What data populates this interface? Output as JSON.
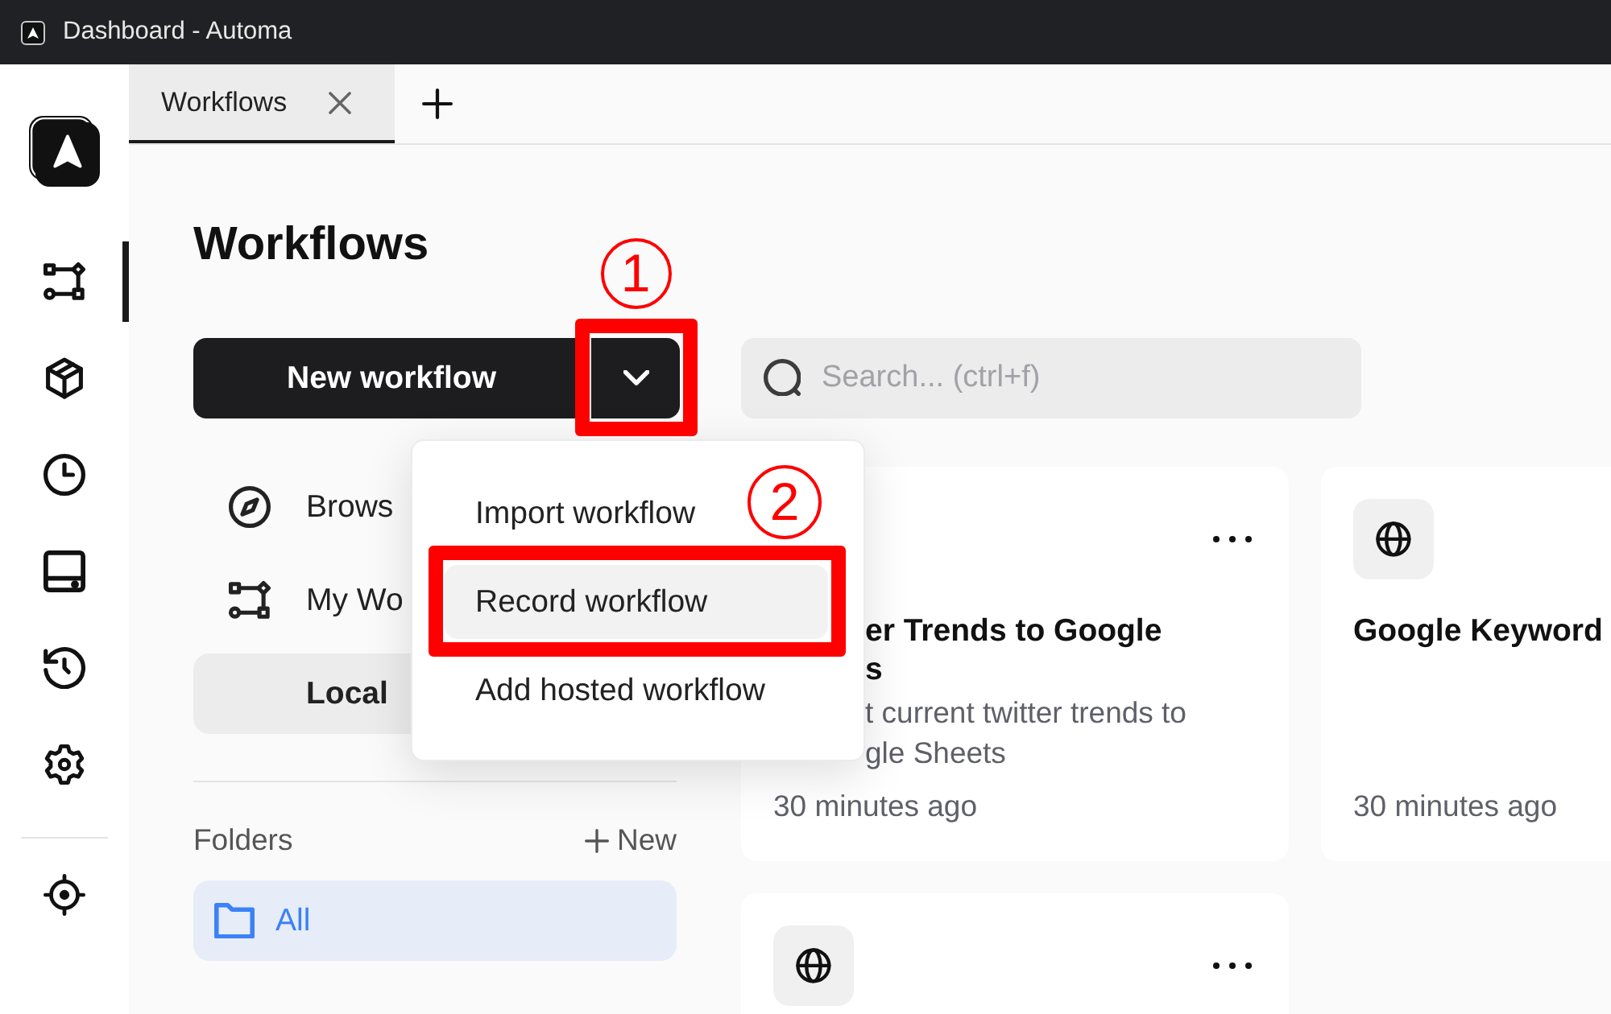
{
  "window": {
    "title": "Dashboard - Automa"
  },
  "sidebar": {
    "items": [
      {
        "selected": true
      },
      {
        "selected": false
      },
      {
        "selected": false
      },
      {
        "selected": false
      },
      {
        "selected": false
      },
      {
        "selected": false
      }
    ],
    "bottom_items": [
      {
        "selected": false
      }
    ]
  },
  "tabs": [
    {
      "label": "Workflows",
      "selected": true
    }
  ],
  "page_title": "Workflows",
  "toolbar": {
    "new_button": {
      "label": "New workflow"
    },
    "dropdown_toggle": {
      "callout": "1"
    },
    "search": {
      "placeholder": "Search... (ctrl+f)"
    }
  },
  "menu": {
    "items": [
      {
        "label": "Import workflow",
        "highlighted": false
      },
      {
        "label": "Record workflow",
        "highlighted": true,
        "callout": "2"
      },
      {
        "label": "Add hosted workflow",
        "highlighted": false
      }
    ]
  },
  "nav": [
    {
      "label": "Brows",
      "kind": "link",
      "selected": false
    },
    {
      "label": "My Wo",
      "kind": "link",
      "selected": false
    },
    {
      "label": "Local",
      "kind": "tab",
      "selected": true
    }
  ],
  "folders": {
    "title": "Folders",
    "new_label": "New",
    "items": [
      {
        "name": "All",
        "selected": true
      }
    ]
  },
  "cards": [
    {
      "icon_tile": false,
      "more_button": true,
      "covered": true,
      "title_lines": [
        "er Trends to Google",
        "s"
      ],
      "description_lines": [
        "t current twitter trends to",
        "gle Sheets"
      ],
      "time": "30 minutes ago"
    },
    {
      "icon_tile": true,
      "more_button": false,
      "covered": false,
      "title_lines": [
        "Google Keyword"
      ],
      "time": "30 minutes ago"
    },
    {
      "icon_tile": true,
      "more_button": true,
      "covered": false
    }
  ]
}
